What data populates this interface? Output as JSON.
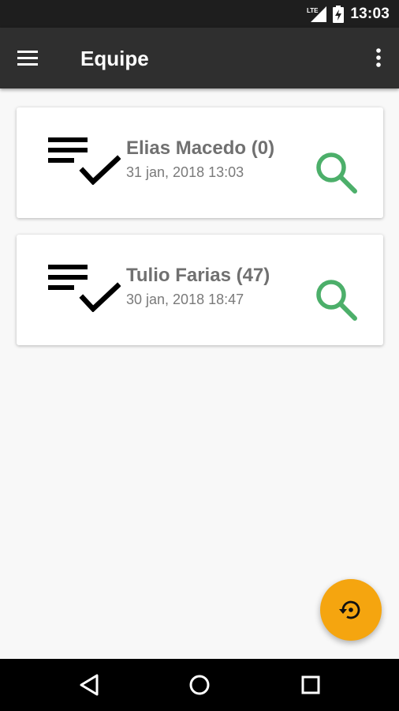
{
  "status_bar": {
    "time": "13:03",
    "network_label": "LTE",
    "icons": [
      "lte-signal-icon",
      "battery-charging-icon"
    ]
  },
  "app_bar": {
    "title": "Equipe",
    "icons": [
      "menu-icon",
      "more-vert-icon"
    ]
  },
  "entries": [
    {
      "name": "Elias Macedo (0)",
      "date": "31 jan, 2018 13:03",
      "icon": "playlist-check-icon",
      "action_icon": "search-icon"
    },
    {
      "name": "Tulio Farias (47)",
      "date": "30 jan, 2018 18:47",
      "icon": "playlist-check-icon",
      "action_icon": "search-icon"
    }
  ],
  "fab": {
    "icon": "restore-icon"
  },
  "nav_bar": {
    "icons": [
      "back-icon",
      "home-icon",
      "recents-icon"
    ]
  },
  "colors": {
    "status_bar": "#1e1e1e",
    "app_bar": "#2f2f2f",
    "background": "#f8f8f8",
    "search_icon": "#4caf6a",
    "fab": "#f5a50f",
    "name_text": "#707070",
    "date_text": "#7a7a7a"
  }
}
